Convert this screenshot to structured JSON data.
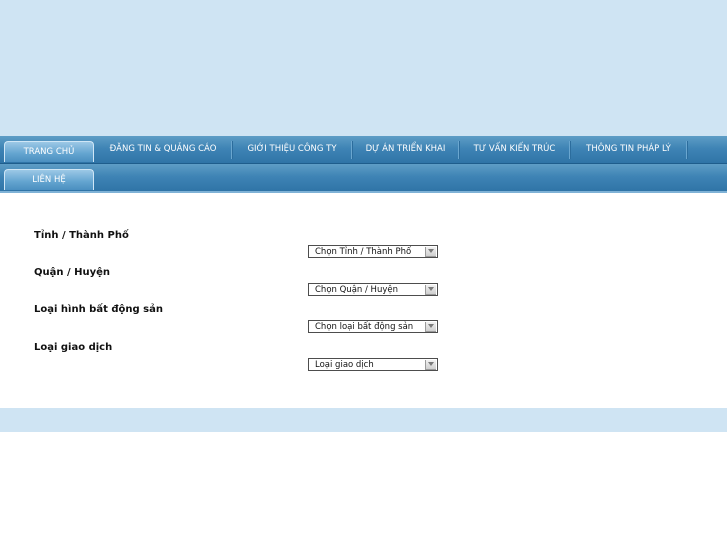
{
  "nav": {
    "row1": [
      {
        "label": "TRANG CHỦ",
        "active": true
      },
      {
        "label": "ĐĂNG TIN & QUẢNG CÁO",
        "active": false
      },
      {
        "label": "GIỚI THIỆU CÔNG TY",
        "active": false
      },
      {
        "label": "DỰ ÁN TRIỂN KHAI",
        "active": false
      },
      {
        "label": "TƯ VẤN KIẾN TRÚC",
        "active": false
      },
      {
        "label": "THÔNG TIN PHÁP LÝ",
        "active": false
      }
    ],
    "row2": [
      {
        "label": "LIÊN HỆ",
        "active": true
      }
    ]
  },
  "form": {
    "fields": [
      {
        "label": "Tỉnh / Thành Phố",
        "select_value": "Chọn Tỉnh / Thành Phố"
      },
      {
        "label": "Quận / Huyện",
        "select_value": "Chọn Quận / Huyện"
      },
      {
        "label": "Loại hình bất động sản",
        "select_value": "Chọn loại bất động sản"
      },
      {
        "label": "Loại giao dịch",
        "select_value": "Loại giao dịch"
      }
    ]
  },
  "colors": {
    "banner": "#cfe4f3",
    "nav_bar": "#3f84b5",
    "footer_band": "#cfe4f3"
  }
}
